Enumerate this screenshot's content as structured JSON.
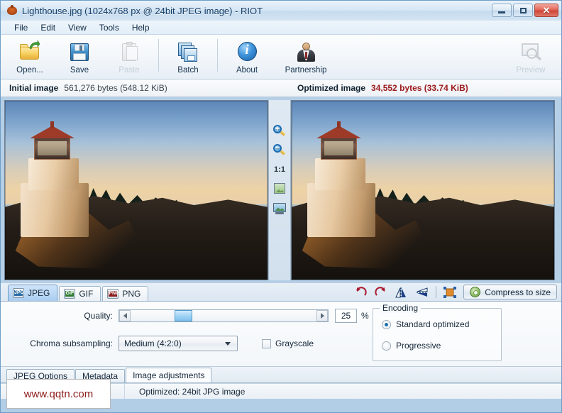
{
  "window": {
    "title": "Lighthouse.jpg (1024x768 px @ 24bit JPEG image) - RIOT",
    "icon": "riot-app-icon",
    "minimize_label": "Minimize",
    "maximize_label": "Maximize",
    "close_label": "✕"
  },
  "menu": {
    "items": [
      {
        "label": "File"
      },
      {
        "label": "Edit"
      },
      {
        "label": "View"
      },
      {
        "label": "Tools"
      },
      {
        "label": "Help"
      }
    ]
  },
  "toolbar": {
    "buttons": [
      {
        "label": "Open...",
        "icon": "open-folder-icon",
        "enabled": true
      },
      {
        "label": "Save",
        "icon": "floppy-disk-icon",
        "enabled": true
      },
      {
        "label": "Paste",
        "icon": "clipboard-icon",
        "enabled": false
      },
      {
        "label": "Batch",
        "icon": "batch-stack-icon",
        "enabled": true
      },
      {
        "label": "About",
        "icon": "info-circle-icon",
        "enabled": true
      },
      {
        "label": "Partnership",
        "icon": "person-icon",
        "enabled": true
      }
    ],
    "preview": {
      "label": "Preview",
      "icon": "preview-magnifier-icon",
      "enabled": false
    }
  },
  "info_bar": {
    "initial_label": "Initial image",
    "initial_value": "561,276 bytes (548.12 KiB)",
    "optimized_label": "Optimized image",
    "optimized_value": "34,552 bytes (33.74 KiB)",
    "optimized_color": "#9b1a1a"
  },
  "preview": {
    "left_pane_name": "initial-image-preview",
    "right_pane_name": "optimized-image-preview",
    "center_tools": [
      {
        "name": "zoom-in-icon",
        "label": "+"
      },
      {
        "name": "zoom-out-icon",
        "label": "−"
      },
      {
        "name": "zoom-actual-size-button",
        "label": "1:1"
      },
      {
        "name": "fit-image-icon",
        "label": ""
      },
      {
        "name": "fullscreen-preview-icon",
        "label": ""
      }
    ]
  },
  "format_tabs": {
    "items": [
      {
        "label": "JPEG",
        "icon": "jpg-file-icon",
        "badge": "JPG",
        "active": true
      },
      {
        "label": "GIF",
        "icon": "gif-file-icon",
        "badge": "GIF",
        "active": false
      },
      {
        "label": "PNG",
        "icon": "png-file-icon",
        "badge": "PNG",
        "active": false
      }
    ],
    "tools": [
      {
        "name": "rotate-left-icon"
      },
      {
        "name": "rotate-right-icon"
      },
      {
        "name": "flip-horizontal-icon"
      },
      {
        "name": "flip-vertical-icon"
      },
      {
        "name": "resize-image-icon"
      }
    ],
    "compress_button": {
      "label": "Compress to size",
      "icon": "gear-icon"
    }
  },
  "options": {
    "quality_label": "Quality:",
    "quality_value": "25",
    "quality_unit": "%",
    "quality_percent": 25,
    "chroma_label": "Chroma subsampling:",
    "chroma_value": "Medium (4:2:0)",
    "grayscale_label": "Grayscale",
    "grayscale_checked": false,
    "encoding": {
      "title": "Encoding",
      "options": [
        {
          "label": "Standard optimized",
          "selected": true
        },
        {
          "label": "Progressive",
          "selected": false
        }
      ]
    }
  },
  "bottom_tabs": {
    "items": [
      {
        "label": "JPEG Options",
        "active": false
      },
      {
        "label": "Metadata",
        "active": false
      },
      {
        "label": "Image adjustments",
        "active": true
      }
    ]
  },
  "status_bar": {
    "left": "",
    "right": "Optimized: 24bit JPG image"
  },
  "watermark": {
    "text": "www.qqtn.com",
    "color": "#8e1c1c"
  }
}
